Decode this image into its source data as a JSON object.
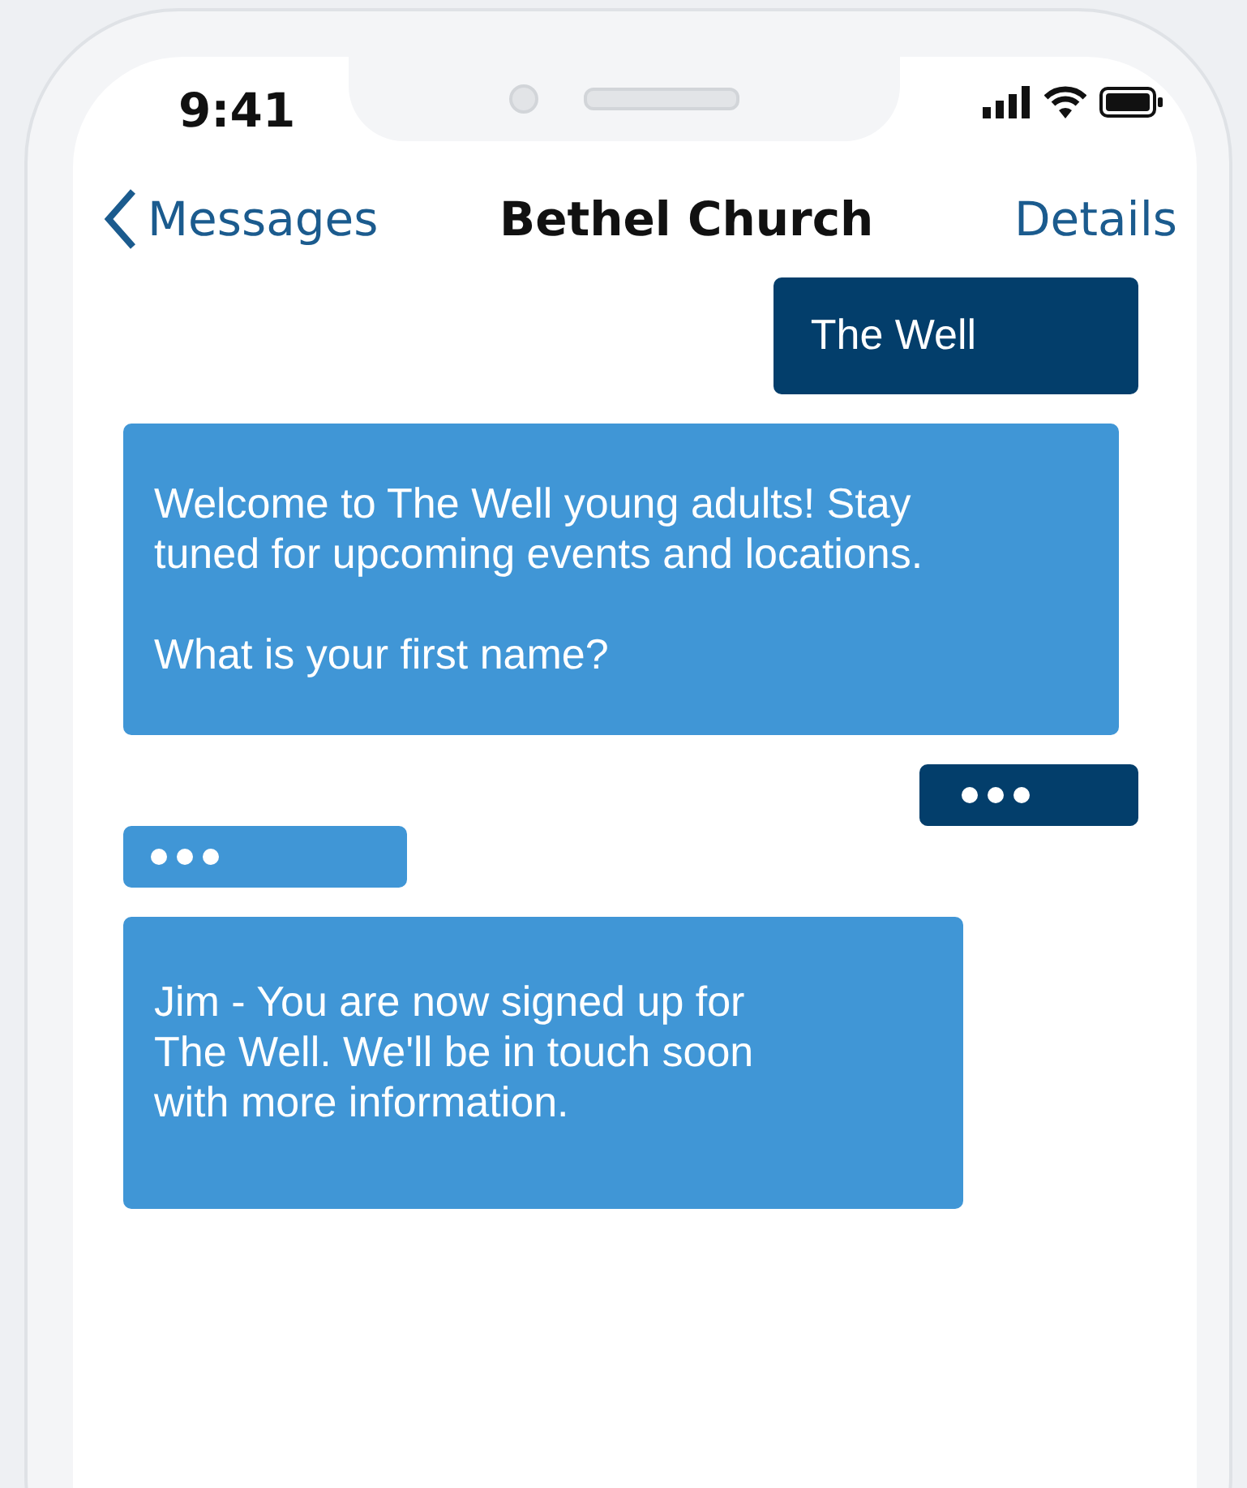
{
  "status_bar": {
    "time": "9:41"
  },
  "nav": {
    "back": "Messages",
    "title": "Bethel Church",
    "action": "Details"
  },
  "messages": [
    {
      "kind": "text",
      "sent": true,
      "paragraphs": [
        "The Well"
      ]
    },
    {
      "kind": "text",
      "sent": false,
      "paragraphs": [
        "Welcome to The Well young adults! Stay tuned for upcoming events and locations.",
        "What is your first name?"
      ]
    },
    {
      "kind": "typing",
      "sent": true
    },
    {
      "kind": "typing",
      "sent": false
    },
    {
      "kind": "text",
      "sent": false,
      "paragraphs": [
        "Jim - You are now signed up for The Well. We'll be in touch soon with more information."
      ]
    }
  ]
}
